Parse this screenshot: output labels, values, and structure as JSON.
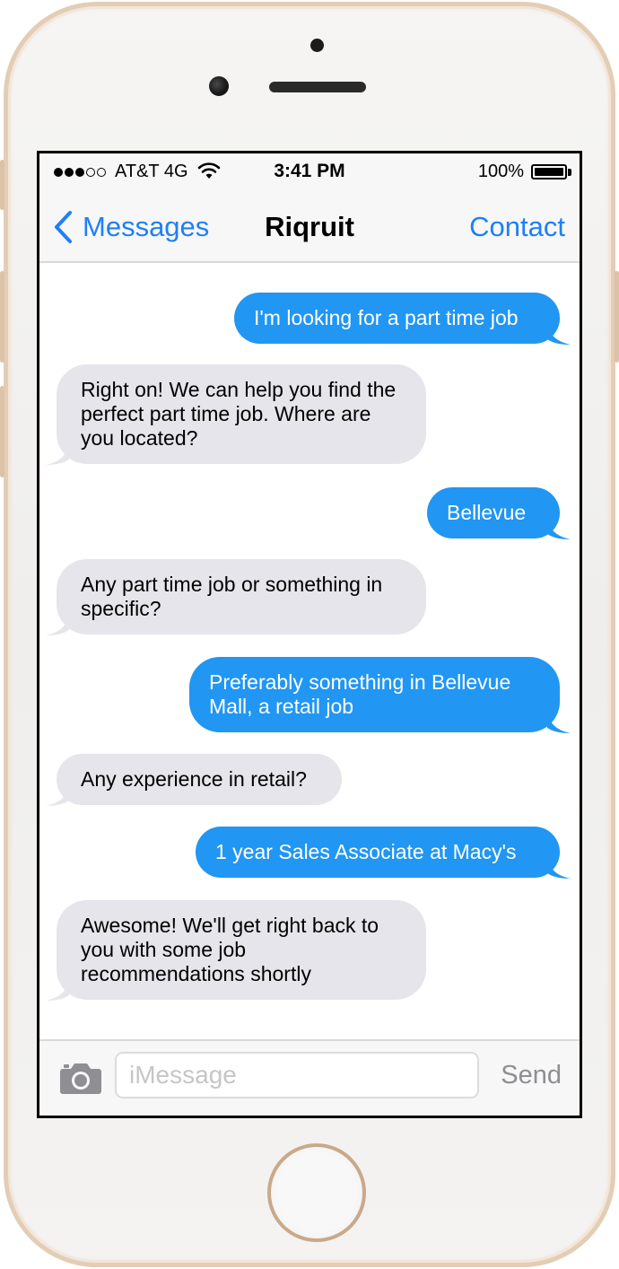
{
  "status_bar": {
    "carrier": "AT&T 4G",
    "time": "3:41 PM",
    "battery": "100%"
  },
  "nav": {
    "back_label": "Messages",
    "title": "Riqruit",
    "action_label": "Contact"
  },
  "messages": [
    {
      "direction": "out",
      "text": "I'm looking for a part time job"
    },
    {
      "direction": "in",
      "text": "Right on! We can help you find the perfect part time job. Where are you located?"
    },
    {
      "direction": "out",
      "text": "Bellevue"
    },
    {
      "direction": "in",
      "text": "Any part time job or something in specific?"
    },
    {
      "direction": "out",
      "text": "Preferably something in Bellevue Mall, a retail job"
    },
    {
      "direction": "in",
      "text": "Any experience in retail?"
    },
    {
      "direction": "out",
      "text": "1 year Sales Associate at Macy's"
    },
    {
      "direction": "in",
      "text": "Awesome! We'll get right back to you with some job recommendations shortly"
    }
  ],
  "composer": {
    "placeholder": "iMessage",
    "send_label": "Send",
    "camera_icon": "camera-icon"
  },
  "colors": {
    "accent": "#1f7ff5",
    "outgoing_bubble": "#2196f3",
    "incoming_bubble": "#e6e5eb",
    "frame": "#e3cdb6"
  }
}
